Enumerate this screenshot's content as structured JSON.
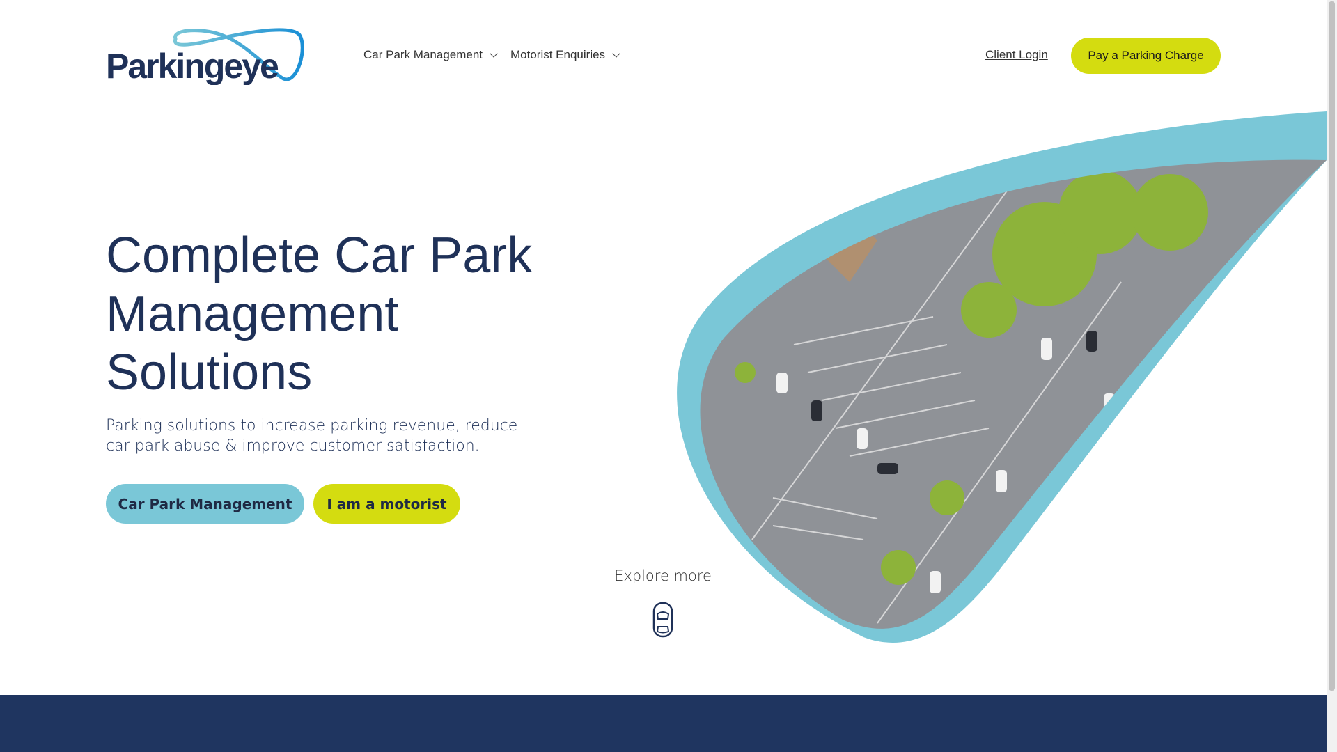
{
  "header": {
    "logo_text": "Parkingeye",
    "nav": [
      {
        "label": "Car Park Management"
      },
      {
        "label": "Motorist Enquiries"
      }
    ],
    "client_login": "Client Login",
    "pay_button": "Pay a Parking Charge"
  },
  "hero": {
    "title": "Complete Car Park Management Solutions",
    "subtitle": "Parking solutions to increase parking revenue, reduce car park abuse & improve customer satisfaction.",
    "buttons": [
      {
        "label": "Car Park Management"
      },
      {
        "label": "I am a motorist"
      }
    ],
    "explore": "Explore more"
  },
  "colors": {
    "navy": "#1f3158",
    "teal": "#7ac7d7",
    "lime": "#d4dc10",
    "footer": "#1f3560"
  }
}
